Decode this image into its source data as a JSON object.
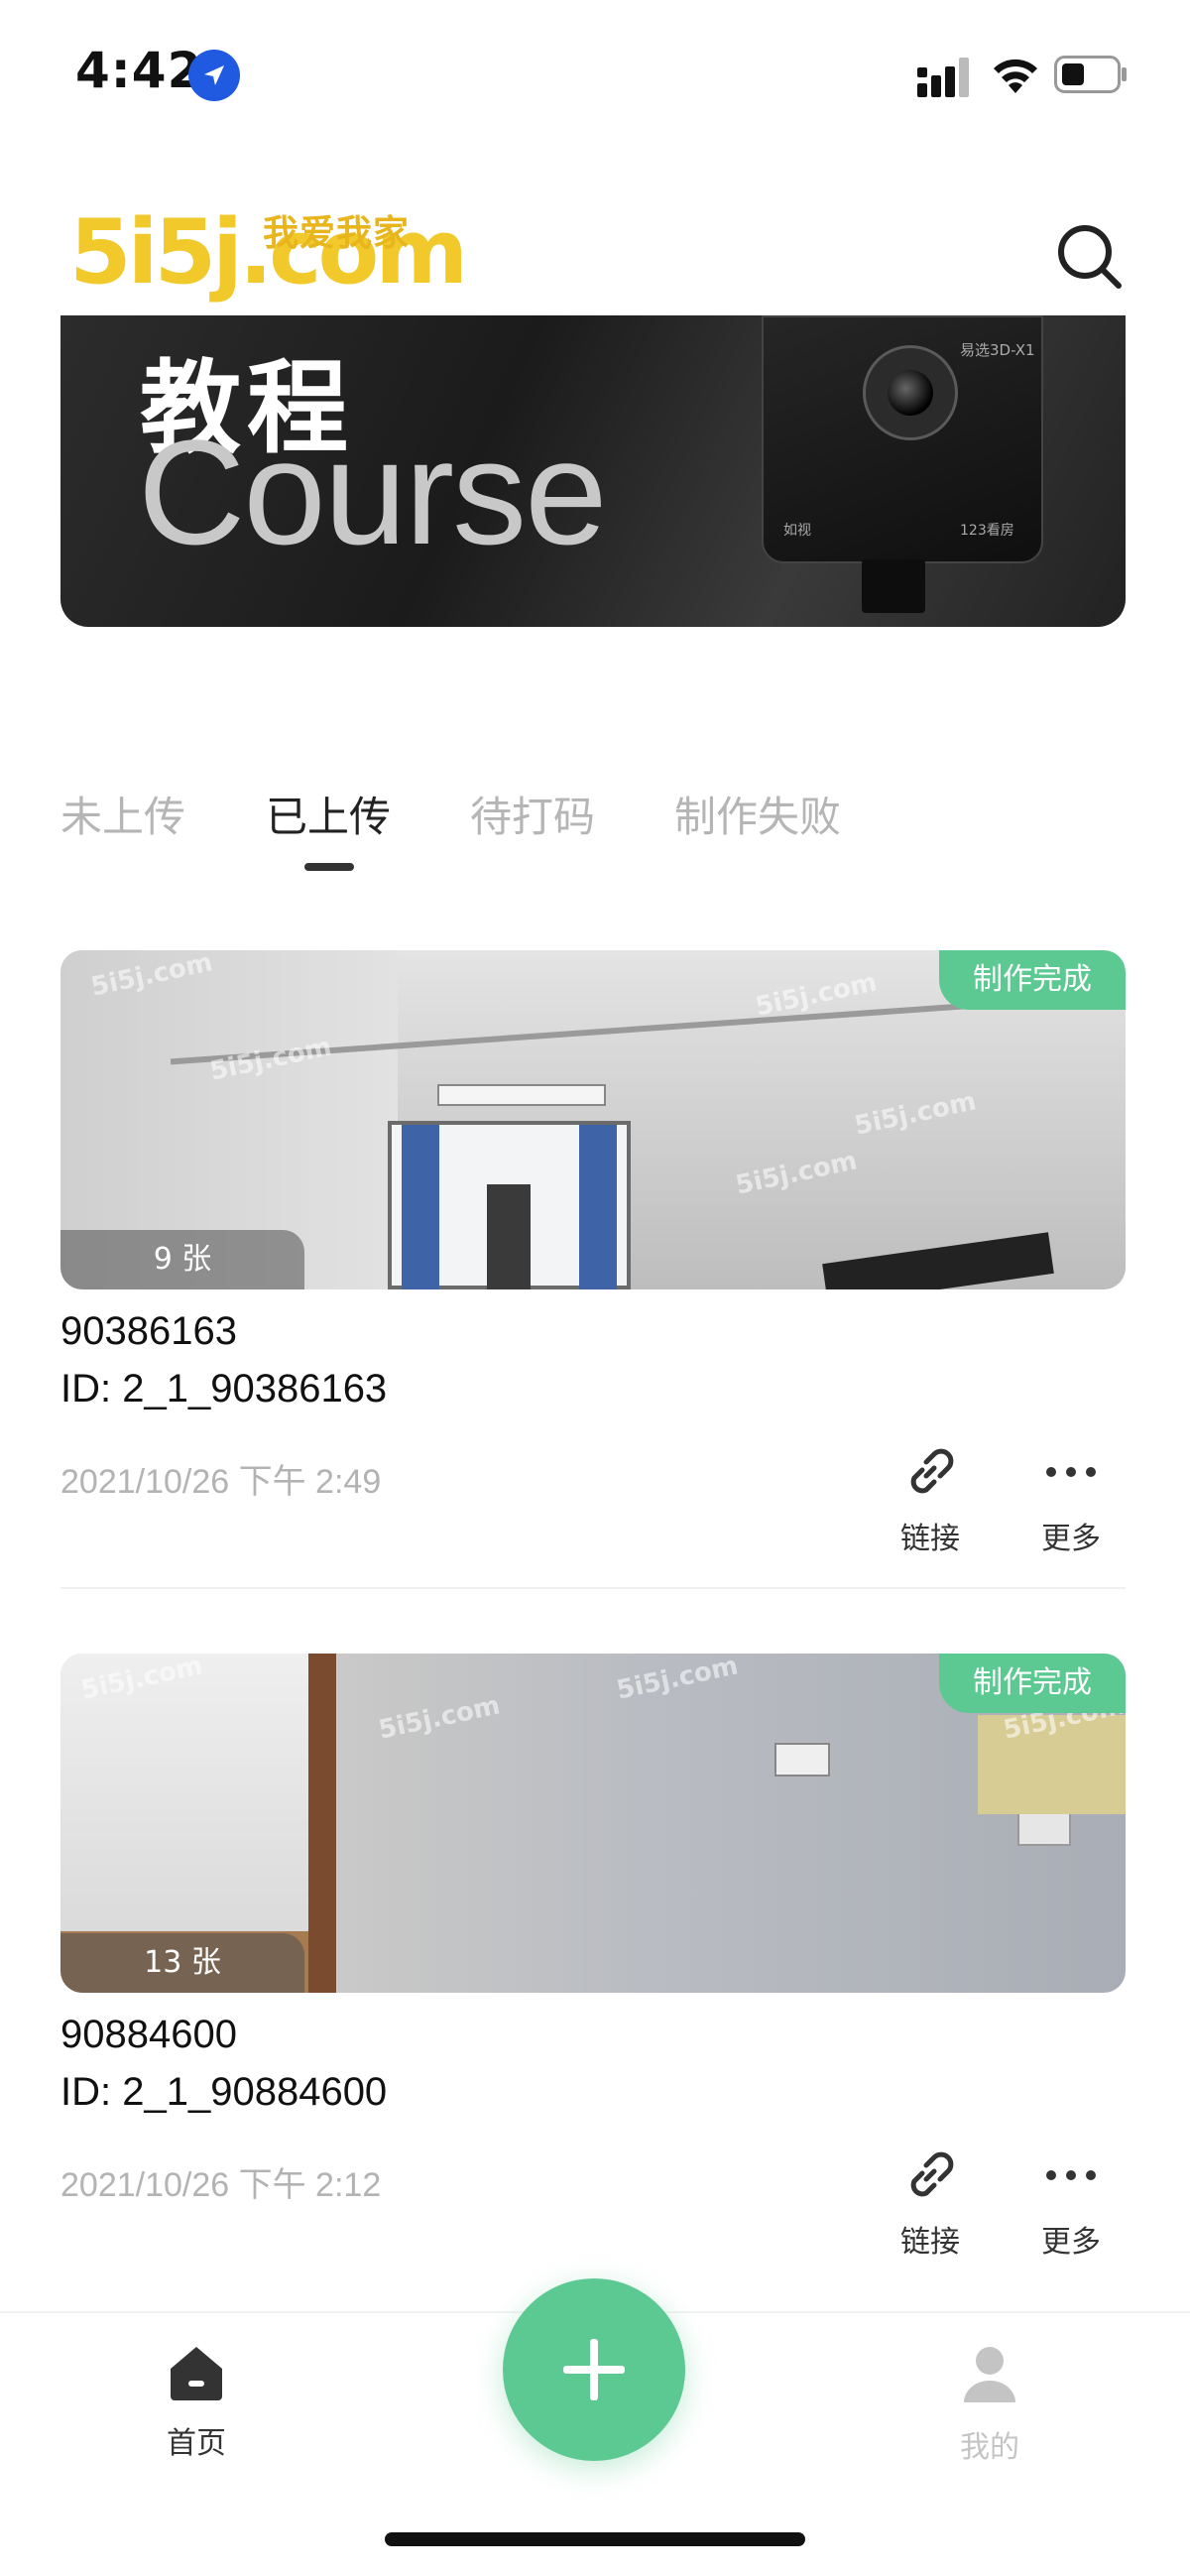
{
  "status_bar": {
    "time": "4:42"
  },
  "header": {
    "logo_main": "5i5j.com",
    "logo_cn": "我爱我家"
  },
  "banner": {
    "title_cn": "教程",
    "title_en": "Course",
    "camera_model": "易选3D-X1",
    "camera_brand_left": "如视",
    "camera_brand_right": "123看房"
  },
  "tabs": [
    {
      "label": "未上传",
      "active": false
    },
    {
      "label": "已上传",
      "active": true
    },
    {
      "label": "待打码",
      "active": false
    },
    {
      "label": "制作失败",
      "active": false
    }
  ],
  "cards": [
    {
      "status": "制作完成",
      "count": "9 张",
      "title": "90386163",
      "id": "ID: 2_1_90386163",
      "time": "2021/10/26 下午 2:49",
      "link_label": "链接",
      "more_label": "更多"
    },
    {
      "status": "制作完成",
      "count": "13 张",
      "title": "90884600",
      "id": "ID: 2_1_90884600",
      "time": "2021/10/26 下午 2:12",
      "link_label": "链接",
      "more_label": "更多"
    }
  ],
  "watermark": "5i5j.com",
  "bottom_nav": {
    "home_label": "首页",
    "mine_label": "我的",
    "active_color": "#333333",
    "inactive_color": "#c4c4c4",
    "fab_color": "#5cc892"
  }
}
